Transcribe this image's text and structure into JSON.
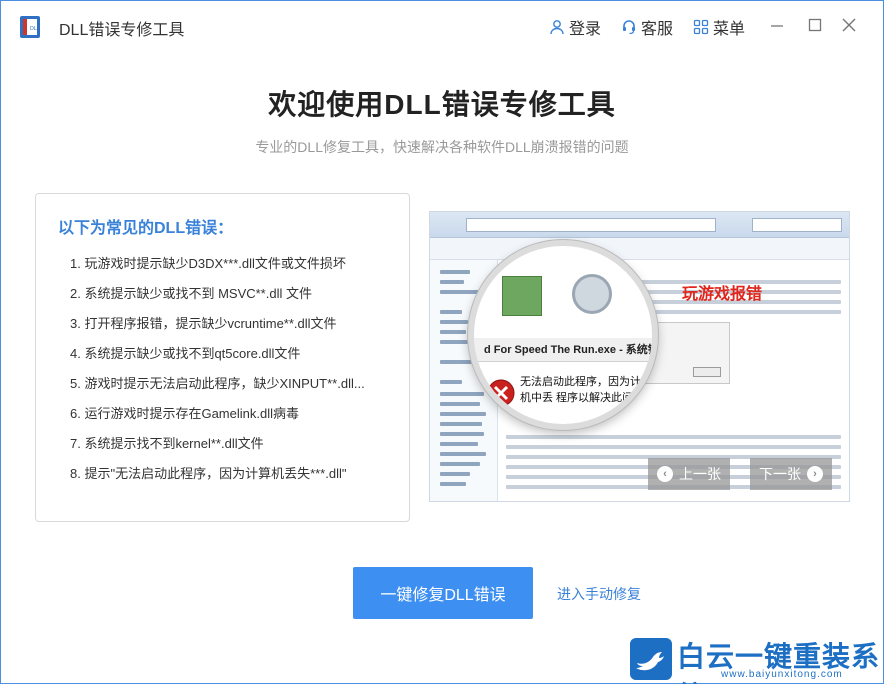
{
  "app": {
    "title": "DLL错误专修工具",
    "logo_text": "DLL"
  },
  "header": {
    "login_label": "登录",
    "service_label": "客服",
    "menu_label": "菜单"
  },
  "hero": {
    "title": "欢迎使用DLL错误专修工具",
    "subtitle": "专业的DLL修复工具，快速解决各种软件DLL崩溃报错的问题"
  },
  "errors": {
    "heading": "以下为常见的DLL错误：",
    "items": [
      "1. 玩游戏时提示缺少D3DX***.dll文件或文件损坏",
      "2. 系统提示缺少或找不到 MSVC**.dll 文件",
      "3. 打开程序报错，提示缺少vcruntime**.dll文件",
      "4. 系统提示缺少或找不到qt5core.dll文件",
      "5. 游戏时提示无法启动此程序，缺少XINPUT**.dll...",
      "6. 运行游戏时提示存在Gamelink.dll病毒",
      "7. 系统提示找不到kernel**.dll文件",
      "8. 提示\"无法启动此程序，因为计算机丢失***.dll\""
    ]
  },
  "illustration": {
    "tag": "玩游戏报错",
    "dialog_title": "d For Speed The Run.exe - 系统错误",
    "dialog_message": "无法启动此程序，因为计算机中丢 程序以解决此问题。",
    "prev_label": "上一张",
    "next_label": "下一张"
  },
  "actions": {
    "fix_label": "一键修复DLL错误",
    "manual_label": "进入手动修复"
  },
  "watermark": {
    "name": "白云一键重装系统",
    "url": "www.baiyunxitong.com"
  },
  "colors": {
    "accent": "#3d8ff2",
    "link": "#3a82d9",
    "error_tag": "#e0261c"
  }
}
